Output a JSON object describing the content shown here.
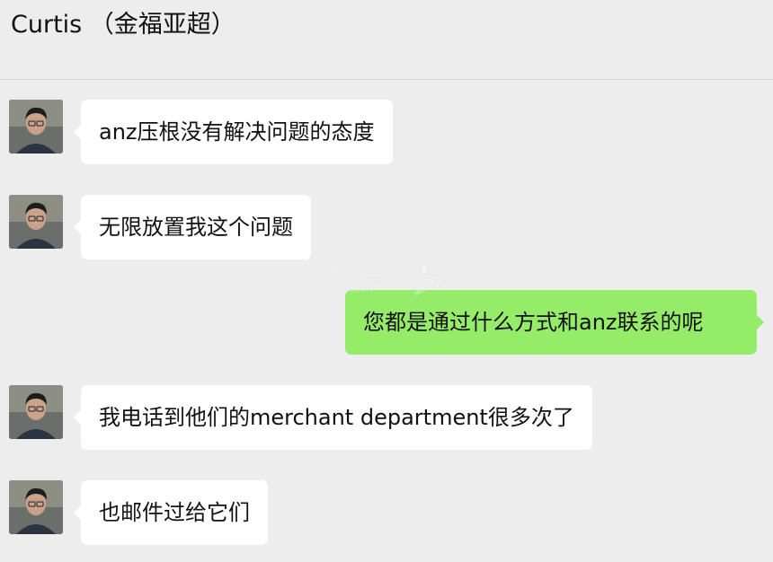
{
  "header": {
    "title": "Curtis （金福亚超）"
  },
  "messages": [
    {
      "side": "left",
      "text": "anz压根没有解决问题的态度",
      "avatar": "avatar-curtis"
    },
    {
      "side": "left",
      "text": "无限放置我这个问题",
      "avatar": "avatar-curtis"
    },
    {
      "side": "right",
      "text": "您都是通过什么方式和anz联系的呢"
    },
    {
      "side": "left",
      "text": "我电话到他们的merchant department很多次了",
      "avatar": "avatar-curtis"
    },
    {
      "side": "left",
      "text": "也邮件过给它们",
      "avatar": "avatar-curtis"
    }
  ],
  "watermark": {
    "cn": "海外掘金",
    "en": "Jinyabian",
    "icon": "runner-logo-icon"
  },
  "colors": {
    "background": "#ededed",
    "incoming_bubble": "#ffffff",
    "outgoing_bubble": "#95ec69",
    "text": "#111111"
  }
}
